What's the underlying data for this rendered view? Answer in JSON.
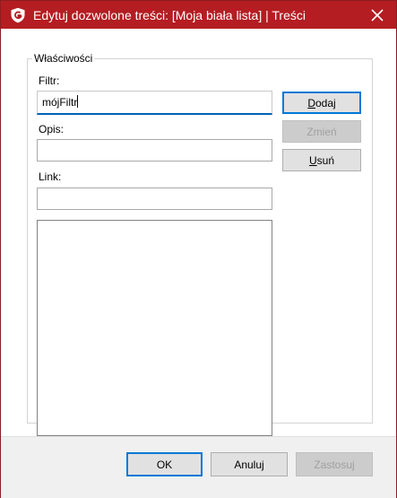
{
  "window": {
    "title": "Edytuj dozwolone treści: [Moja biała lista]  | Treści",
    "accent": "#b41d22"
  },
  "properties": {
    "group_label": "Właściwości",
    "filter_label": "Filtr:",
    "filter_value": "mójFiltr",
    "description_label": "Opis:",
    "description_value": "",
    "link_label": "Link:",
    "link_value": ""
  },
  "side_buttons": {
    "add_label": "Dodaj",
    "add_mnemonic": "D",
    "change_label": "Zmień",
    "remove_label": "Usuń",
    "remove_mnemonic": "U"
  },
  "footer": {
    "ok_label": "OK",
    "cancel_label": "Anuluj",
    "apply_label": "Zastosuj"
  },
  "icons": {
    "logo": "g-data-shield-icon",
    "close": "close-icon"
  }
}
